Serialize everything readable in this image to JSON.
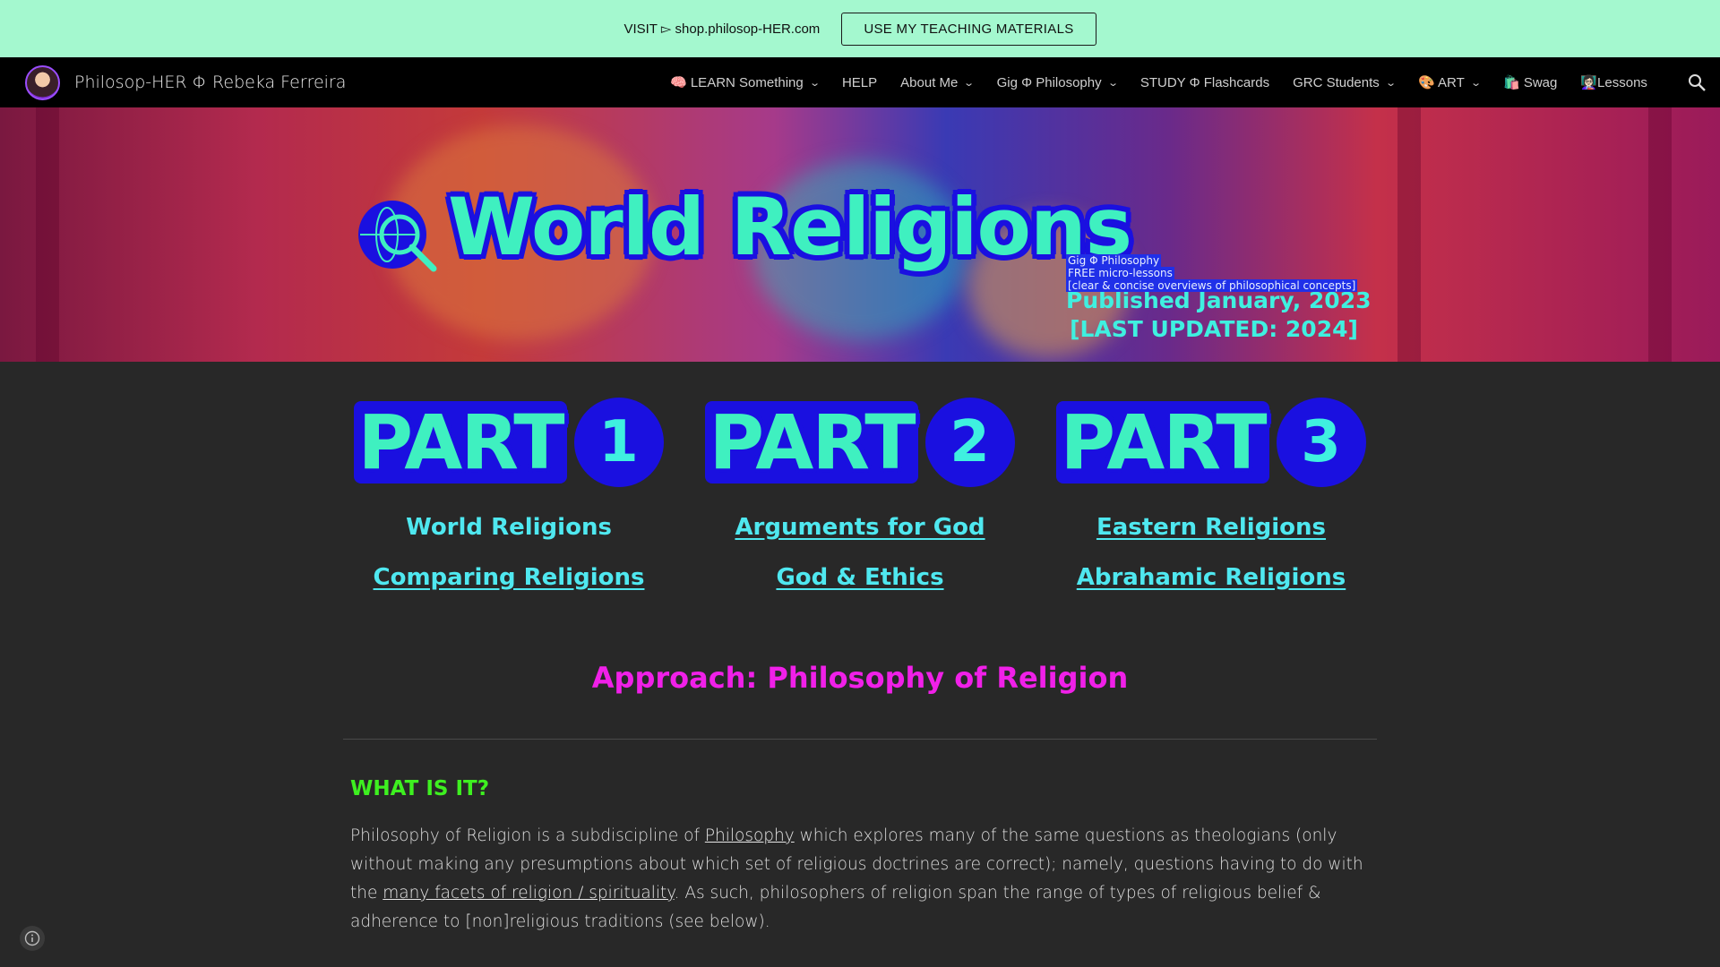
{
  "promo": {
    "text": "VISIT ▻ shop.philosop-HER.com",
    "button_label": "USE MY TEACHING MATERIALS"
  },
  "nav": {
    "site_title": "Philosop-HER Φ Rebeka Ferreira",
    "items": [
      {
        "label": "🧠 LEARN Something",
        "dropdown": true
      },
      {
        "label": "HELP",
        "dropdown": false
      },
      {
        "label": "About Me",
        "dropdown": true
      },
      {
        "label": "Gig Φ Philosophy",
        "dropdown": true
      },
      {
        "label": "STUDY Φ Flashcards",
        "dropdown": false
      },
      {
        "label": "GRC Students",
        "dropdown": true
      },
      {
        "label": "🎨 ART",
        "dropdown": true
      },
      {
        "label": "🛍️ Swag",
        "dropdown": false
      },
      {
        "label": "👩🏻‍🏫Lessons",
        "dropdown": false
      }
    ]
  },
  "hero": {
    "title": "World Religions",
    "published": "Published January, 2023",
    "updated": "[LAST UPDATED: 2024]",
    "small_lines": [
      "Gig Φ Philosophy",
      "FREE micro-lessons",
      "[clear & concise overviews of philosophical concepts]"
    ]
  },
  "parts": [
    {
      "word": "PART",
      "number": "1",
      "links": [
        "World Religions",
        "Comparing Religions"
      ]
    },
    {
      "word": "PART",
      "number": "2",
      "links": [
        "Arguments for God",
        "God & Ethics"
      ]
    },
    {
      "word": "PART",
      "number": "3",
      "links": [
        "Eastern Religions",
        "Abrahamic Religions"
      ]
    }
  ],
  "approach": "Approach: Philosophy of Religion",
  "what_is_it": {
    "heading": "WHAT IS IT?",
    "text_1": "Philosophy of Religion is a subdiscipline of ",
    "link_1": "Philosophy",
    "text_2": " which explores many of the same questions as theologians (only without making any presumptions about which set of religious doctrines are correct); namely, questions having to do with the ",
    "link_2": "many facets of religion / spirituality",
    "text_3": ". As such, philosophers of religion span the range of types of religious belief & adherence to [non]religious traditions (see below)."
  },
  "colors": {
    "promo_bg": "#a4f8cf",
    "accent_cyan": "#3ff0c0",
    "accent_blue": "#1a10e0",
    "approach_magenta": "#f020e8",
    "heading_green": "#3ef020"
  }
}
